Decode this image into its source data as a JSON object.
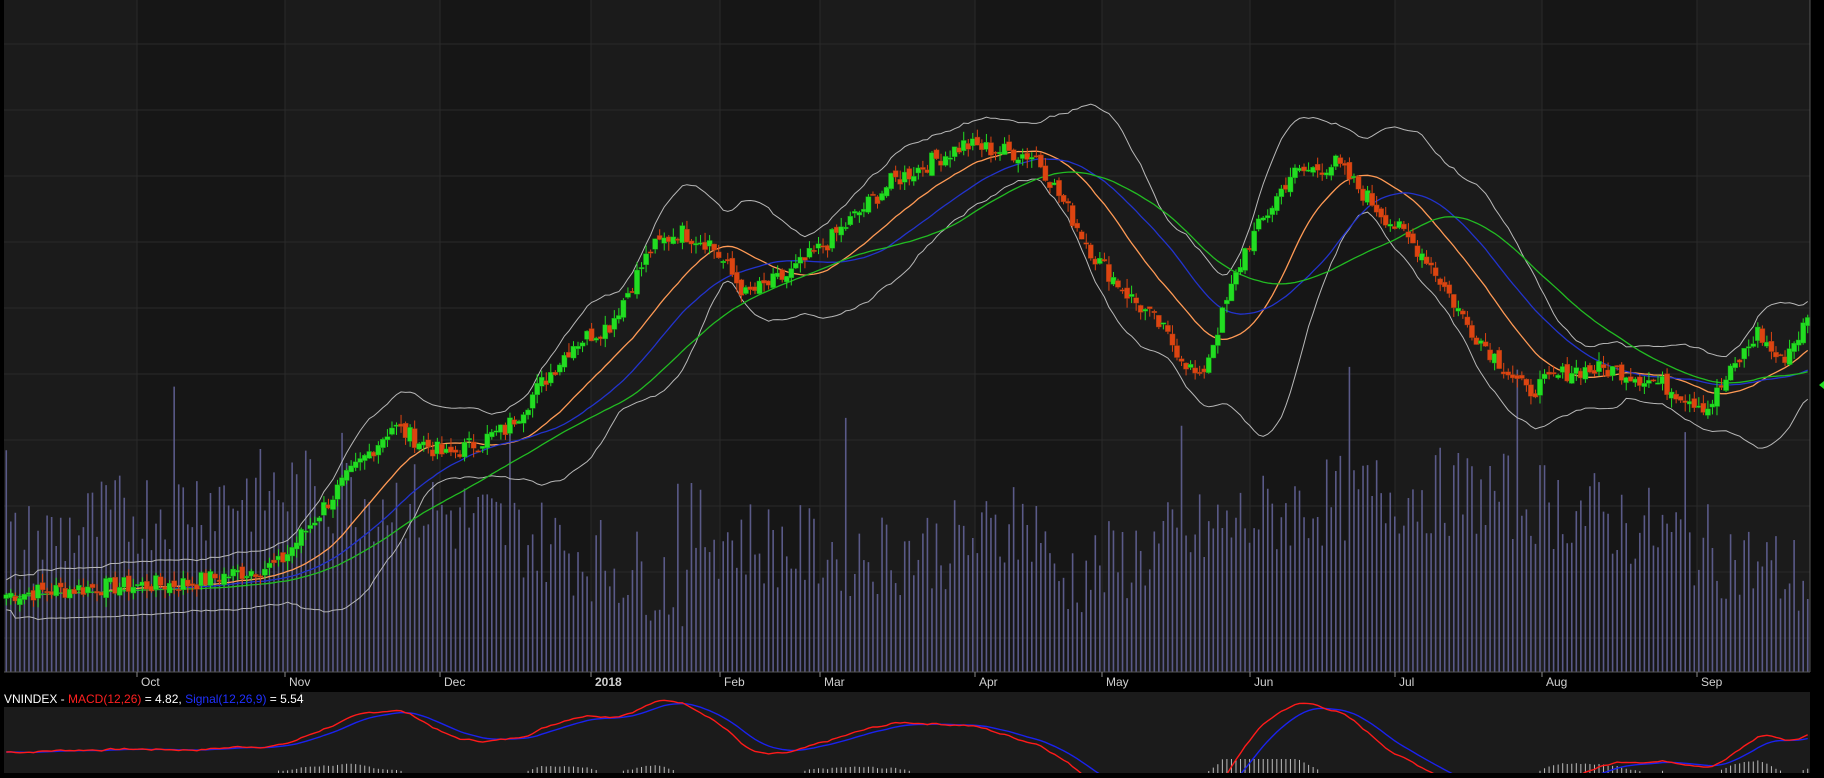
{
  "chart_data": {
    "type": "candlestick",
    "title": "",
    "x_ticks": [
      "Oct",
      "Nov",
      "Dec",
      "2018",
      "Feb",
      "Mar",
      "Apr",
      "May",
      "Jun",
      "Jul",
      "Aug",
      "Sep"
    ],
    "x_tick_bold": "2018",
    "x_range": [
      "2017-09",
      "2018-09"
    ],
    "grid": true,
    "price_keypoints": [
      [
        0,
        18
      ],
      [
        20,
        20
      ],
      [
        40,
        21
      ],
      [
        60,
        26
      ],
      [
        73,
        46
      ],
      [
        85,
        63
      ],
      [
        97,
        55
      ],
      [
        110,
        62
      ],
      [
        125,
        85
      ],
      [
        133,
        90
      ],
      [
        142,
        110
      ],
      [
        148,
        115
      ],
      [
        155,
        112
      ],
      [
        163,
        98
      ],
      [
        172,
        103
      ],
      [
        181,
        112
      ],
      [
        195,
        128
      ],
      [
        211,
        138
      ],
      [
        227,
        135
      ],
      [
        240,
        108
      ],
      [
        248,
        97
      ],
      [
        254,
        90
      ],
      [
        263,
        75
      ],
      [
        273,
        110
      ],
      [
        283,
        130
      ],
      [
        293,
        133
      ],
      [
        303,
        120
      ],
      [
        313,
        108
      ],
      [
        322,
        90
      ],
      [
        335,
        72
      ],
      [
        345,
        78
      ],
      [
        355,
        78
      ],
      [
        365,
        74
      ],
      [
        375,
        68
      ],
      [
        386,
        88
      ],
      [
        391,
        80
      ],
      [
        397,
        91
      ]
    ],
    "series": [
      {
        "name": "price",
        "color": "#22dd22",
        "down_color": "#dd4411"
      },
      {
        "color": "#ff9a55"
      },
      {
        "color": "#2233cc"
      },
      {
        "color": "#22bb22"
      },
      {
        "color": "#b8b8b8"
      },
      {
        "color": "#5a5a88"
      }
    ],
    "colors": {
      "background": "#1b1b1b",
      "grid": "#2a2a2a",
      "axis_text": "#d0d0d0",
      "vertical_band": "#161616"
    }
  },
  "macd_panel": {
    "symbol": "VNINDEX",
    "separator": " - ",
    "macd_label": "MACD(12,26)",
    "macd_value": " = 4.82, ",
    "signal_label": "Signal(12,26,9)",
    "signal_value": " = 5.54",
    "macd_color": "#ff1a1a",
    "signal_color": "#1a22ee",
    "hist_color": "#bbbbbb"
  }
}
